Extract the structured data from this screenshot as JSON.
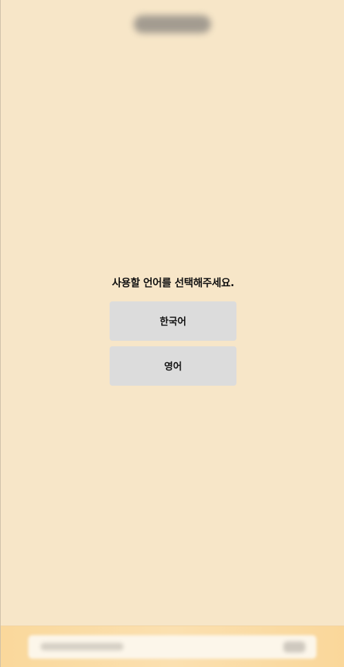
{
  "language_modal": {
    "title": "사용할 언어를 선택해주세요.",
    "options": [
      {
        "label": "한국어"
      },
      {
        "label": "영어"
      }
    ]
  },
  "colors": {
    "background": "#f7e6c8",
    "button": "#dcdcdc",
    "bottom_bar": "#fad89b"
  }
}
